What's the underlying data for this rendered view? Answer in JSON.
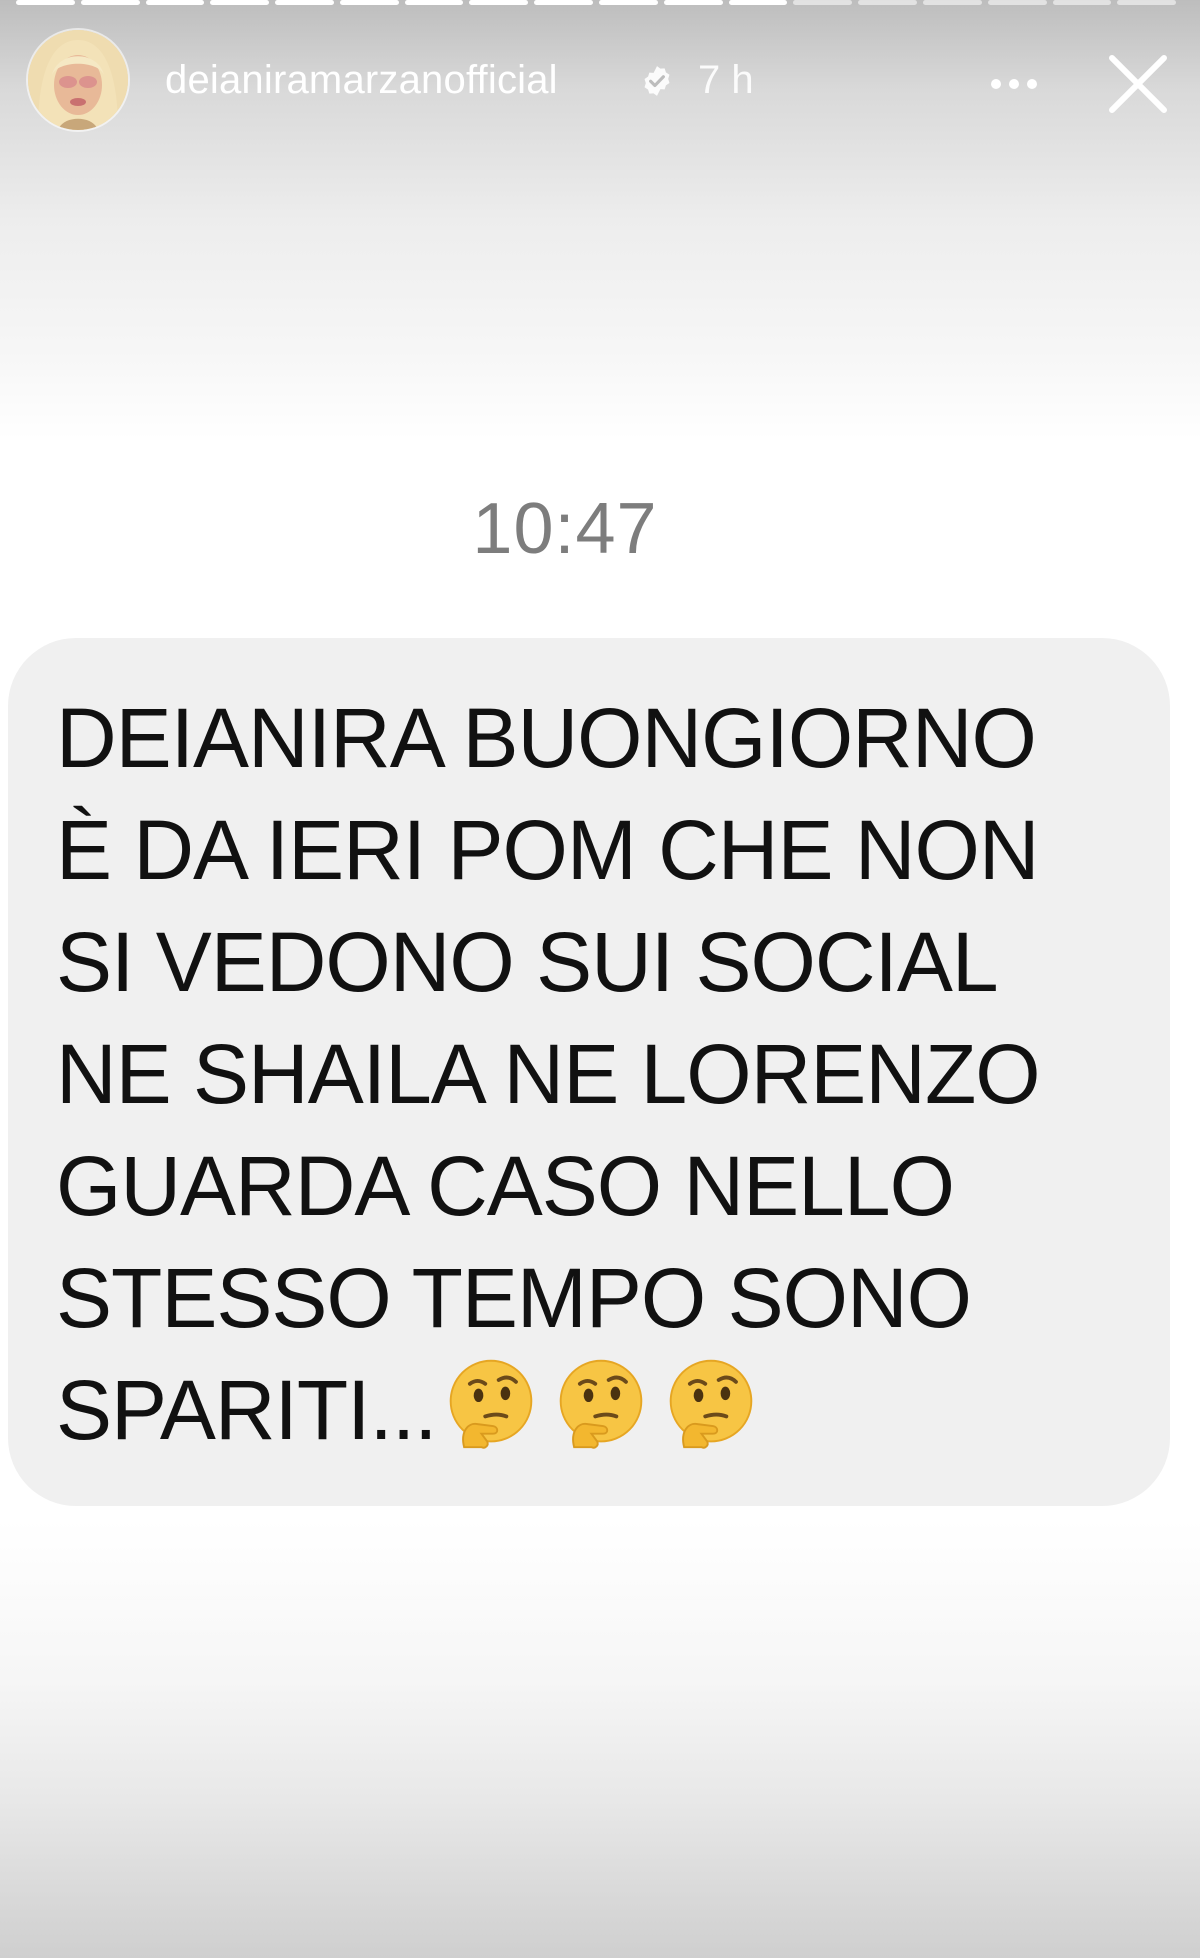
{
  "story": {
    "progress": {
      "segments_total": 18,
      "segments_done": 12
    },
    "header": {
      "username": "deianiramarzanofficial",
      "verified_icon": "verified-badge-icon",
      "time_ago": "7 h",
      "more_icon": "more-icon",
      "close_icon": "close-icon"
    },
    "message": {
      "timestamp": "10:47",
      "text": "DEIANIRA BUONGIORNO\nÈ DA IERI POM CHE NON\nSI VEDONO SUI SOCIAL\nNE SHAILA NE LORENZO\nGUARDA CASO NELLO\nSTESSO TEMPO SONO\nSPARITI...",
      "emojis": [
        "thinking-face-emoji",
        "thinking-face-emoji",
        "thinking-face-emoji"
      ]
    }
  },
  "colors": {
    "bubble": "#f0f0f0",
    "text": "#111111",
    "timestamp": "#7d7d7d",
    "header_text": "#ffffff"
  }
}
